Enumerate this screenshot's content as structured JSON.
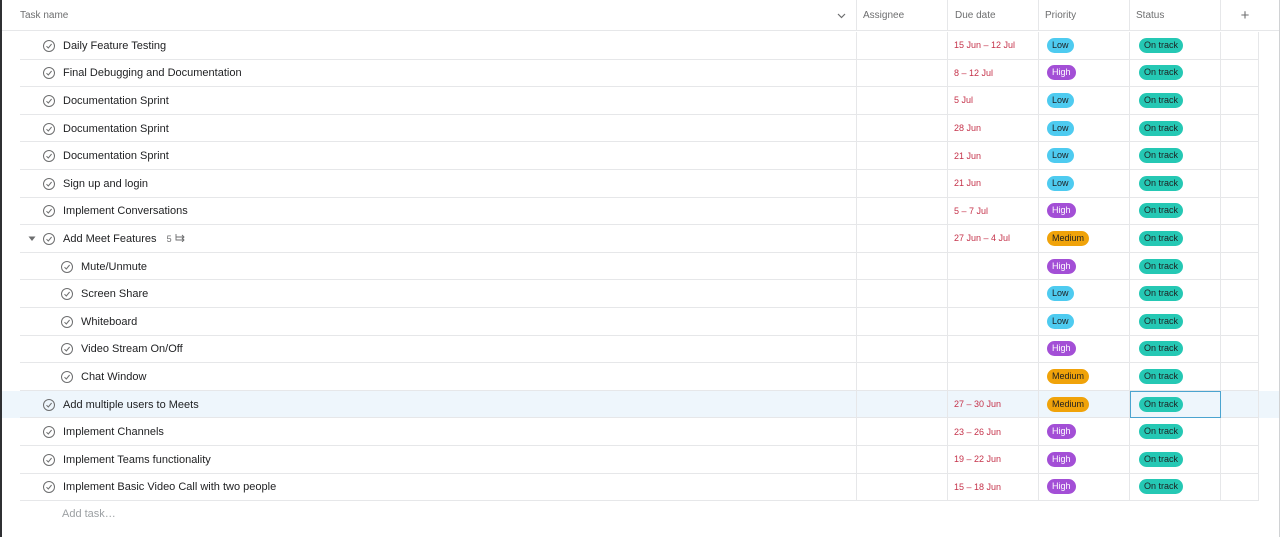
{
  "header": {
    "task_name": "Task name",
    "assignee": "Assignee",
    "due_date": "Due date",
    "priority": "Priority",
    "status": "Status",
    "add_column": "+"
  },
  "colors": {
    "low": "#4ecbf0",
    "high": "#a34fd6",
    "medium": "#f0a30a",
    "on_track": "#25c8b4",
    "due_date_text": "#c5324a"
  },
  "tasks": [
    {
      "name": "Daily Feature Testing",
      "due": "15 Jun – 12 Jul",
      "priority": "Low",
      "status": "On track"
    },
    {
      "name": "Final Debugging and Documentation",
      "due": "8 – 12 Jul",
      "priority": "High",
      "status": "On track"
    },
    {
      "name": "Documentation Sprint",
      "due": "5 Jul",
      "priority": "Low",
      "status": "On track"
    },
    {
      "name": "Documentation Sprint",
      "due": "28 Jun",
      "priority": "Low",
      "status": "On track"
    },
    {
      "name": "Documentation Sprint",
      "due": "21 Jun",
      "priority": "Low",
      "status": "On track"
    },
    {
      "name": "Sign up and login",
      "due": "21 Jun",
      "priority": "Low",
      "status": "On track"
    },
    {
      "name": "Implement Conversations",
      "due": "5 – 7 Jul",
      "priority": "High",
      "status": "On track"
    },
    {
      "name": "Add Meet Features",
      "due": "27 Jun – 4 Jul",
      "priority": "Medium",
      "status": "On track",
      "subtask_count": "5"
    },
    {
      "name": "Mute/Unmute",
      "due": "",
      "priority": "High",
      "status": "On track"
    },
    {
      "name": "Screen Share",
      "due": "",
      "priority": "Low",
      "status": "On track"
    },
    {
      "name": "Whiteboard",
      "due": "",
      "priority": "Low",
      "status": "On track"
    },
    {
      "name": "Video Stream On/Off",
      "due": "",
      "priority": "High",
      "status": "On track"
    },
    {
      "name": "Chat Window",
      "due": "",
      "priority": "Medium",
      "status": "On track"
    },
    {
      "name": "Add multiple users to Meets",
      "due": "27 – 30 Jun",
      "priority": "Medium",
      "status": "On track"
    },
    {
      "name": "Implement Channels",
      "due": "23 – 26 Jun",
      "priority": "High",
      "status": "On track"
    },
    {
      "name": "Implement Teams functionality",
      "due": "19 – 22 Jun",
      "priority": "High",
      "status": "On track"
    },
    {
      "name": "Implement Basic Video Call with two people",
      "due": "15 – 18 Jun",
      "priority": "High",
      "status": "On track"
    }
  ],
  "add_task": "Add task…"
}
